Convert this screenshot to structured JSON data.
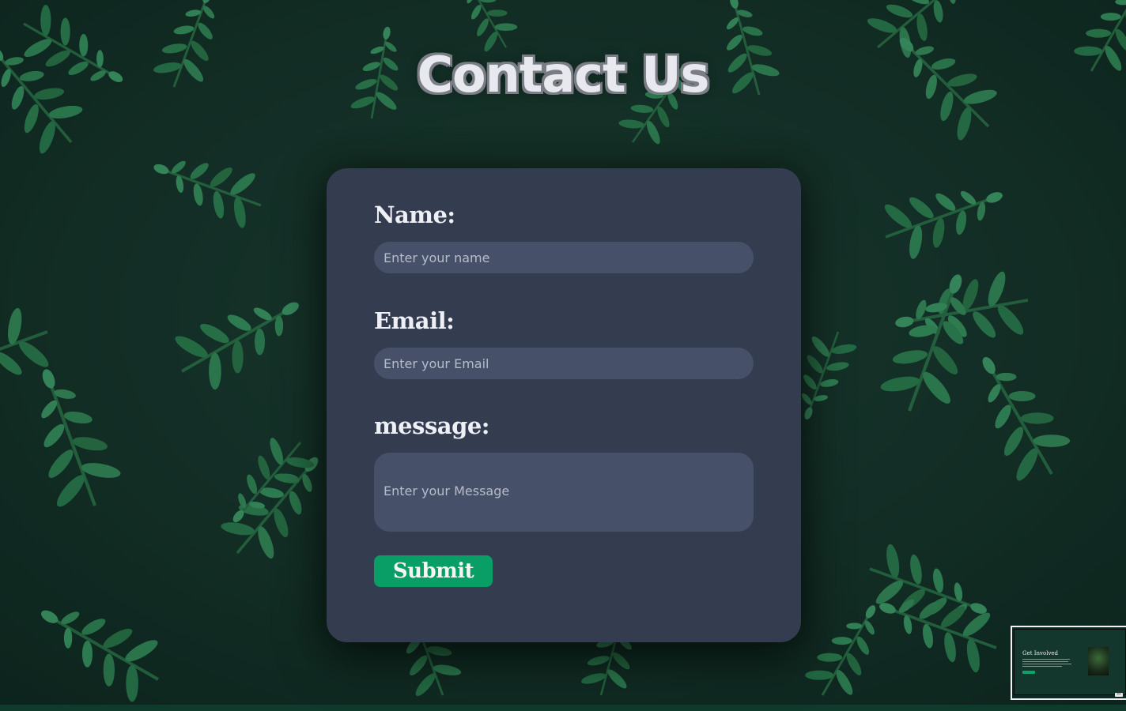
{
  "page": {
    "title": "Contact Us"
  },
  "form": {
    "name_label": "Name:",
    "name_placeholder": "Enter your name",
    "name_value": "",
    "email_label": "Email:",
    "email_placeholder": "Enter your Email",
    "email_value": "",
    "message_label": "message:",
    "message_placeholder": "Enter your Message",
    "message_value": "",
    "submit_label": "Submit"
  },
  "preview_thumbnail": {
    "title": "Get Involved"
  },
  "colors": {
    "card_background": "#343d50",
    "input_background": "#465069",
    "submit_background": "#089e66",
    "page_background": "#13302a"
  },
  "icons": {
    "background": "fern-leaves-background"
  }
}
